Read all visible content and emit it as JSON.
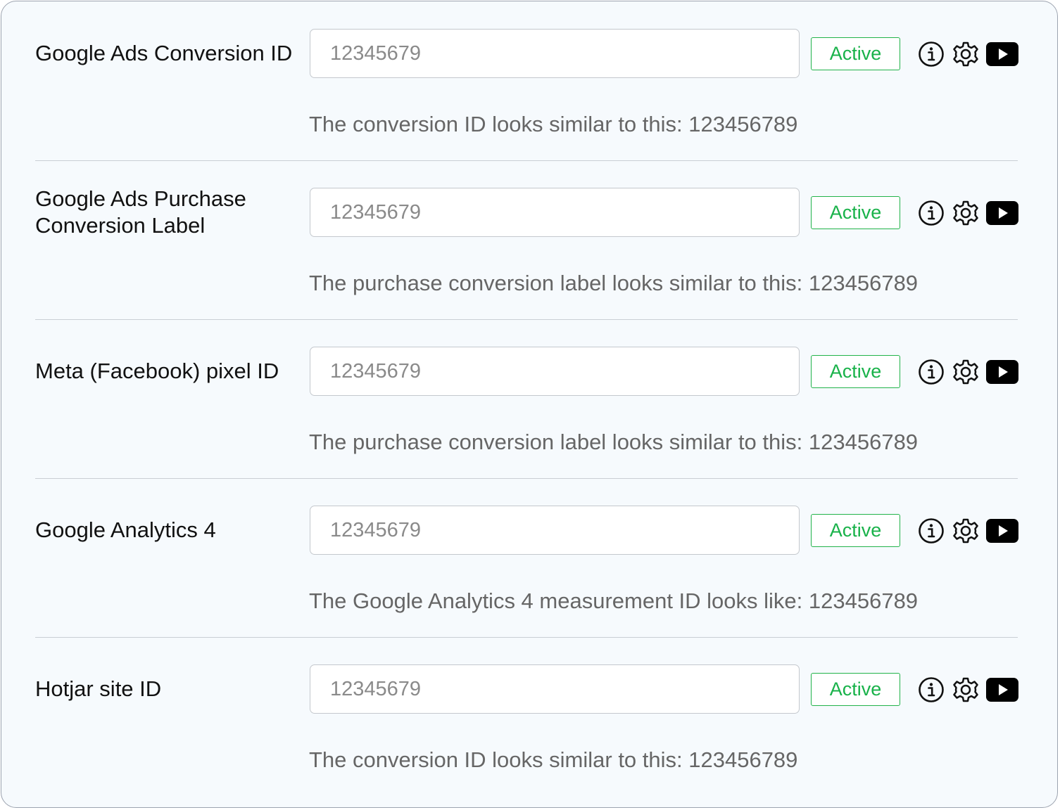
{
  "rows": [
    {
      "label": "Google Ads Conversion ID",
      "placeholder": "12345679",
      "status": "Active",
      "hint": "The conversion ID looks similar to this: 123456789"
    },
    {
      "label": "Google Ads Purchase Conversion Label",
      "placeholder": "12345679",
      "status": "Active",
      "hint": "The purchase conversion label looks similar to this: 123456789"
    },
    {
      "label": "Meta (Facebook) pixel ID",
      "placeholder": "12345679",
      "status": "Active",
      "hint": "The purchase conversion label looks similar to this: 123456789"
    },
    {
      "label": "Google Analytics 4",
      "placeholder": "12345679",
      "status": "Active",
      "hint": "The Google Analytics 4 measurement ID looks like: 123456789"
    },
    {
      "label": "Hotjar site ID",
      "placeholder": "12345679",
      "status": "Active",
      "hint": "The conversion ID looks similar to this: 123456789"
    }
  ],
  "icons": {
    "info": "info-icon",
    "settings": "gear-icon",
    "video": "video-play-icon"
  },
  "colors": {
    "active": "#19b24a",
    "panel_background": "#f6fafd",
    "hint_text": "#666666"
  }
}
